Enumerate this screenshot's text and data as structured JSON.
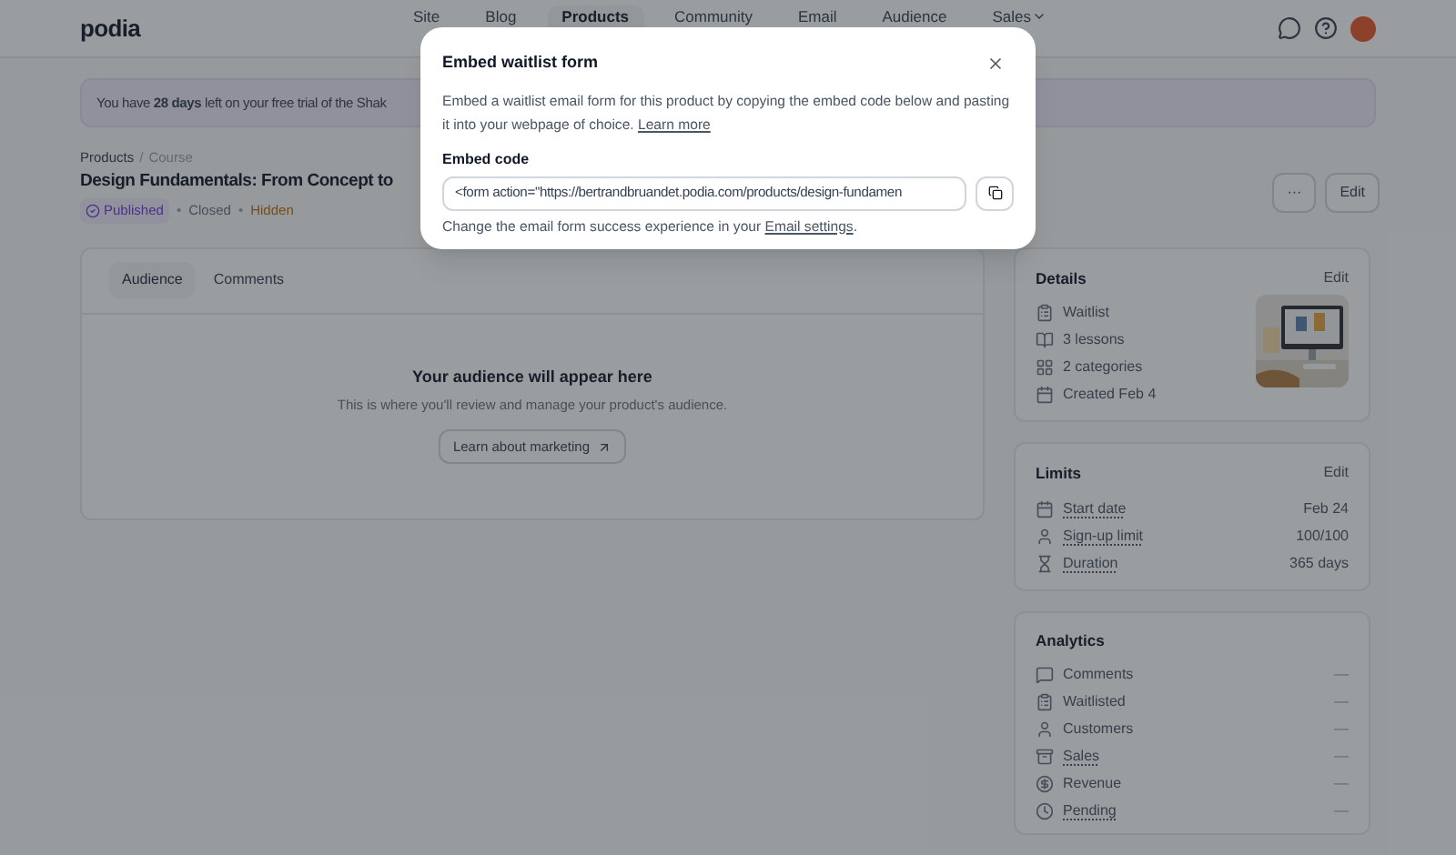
{
  "nav": {
    "logo": "podia",
    "items": [
      {
        "label": "Site",
        "selected": false,
        "has_menu": false
      },
      {
        "label": "Blog",
        "selected": false,
        "has_menu": false
      },
      {
        "label": "Products",
        "selected": true,
        "has_menu": false
      },
      {
        "label": "Community",
        "selected": false,
        "has_menu": false
      },
      {
        "label": "Email",
        "selected": false,
        "has_menu": false
      },
      {
        "label": "Audience",
        "selected": false,
        "has_menu": false
      },
      {
        "label": "Sales",
        "selected": false,
        "has_menu": true
      }
    ]
  },
  "banner": "You have **28 days** left on your free trial of the Shak",
  "breadcrumb": [
    "Products",
    "Course"
  ],
  "breadcrumb_separator": "/",
  "title": "Design Fundamentals: From Concept to",
  "statuses": [
    {
      "label": "Published",
      "kind": "badge"
    },
    {
      "label": "Closed",
      "kind": "plain",
      "prefix": "•"
    },
    {
      "label": "Hidden",
      "kind": "warning",
      "prefix": "•"
    }
  ],
  "actions": [
    "···",
    "Edit"
  ],
  "tabs": [
    {
      "label": "Audience",
      "selected": true
    },
    {
      "label": "Comments",
      "selected": false
    }
  ],
  "empty_state": {
    "title": "Your audience will appear here",
    "text": "This is where you'll review and manage your product's audience.",
    "button": "Learn about marketing"
  },
  "details": {
    "title": "Details",
    "edit": "Edit",
    "items": [
      "Waitlist",
      "3 lessons",
      "2 categories",
      "Created Feb 4"
    ]
  },
  "limits": {
    "title": "Limits",
    "edit": "Edit",
    "rows": [
      {
        "label": "Start date",
        "value": "Feb 24",
        "dotted_underline": true
      },
      {
        "label": "Sign-up limit",
        "value": "100/100",
        "dotted_underline": true
      },
      {
        "label": "Duration",
        "value": "365 days",
        "dotted_underline": true
      }
    ]
  },
  "analytics": {
    "title": "Analytics",
    "rows": [
      {
        "label": "Comments",
        "value": "—",
        "dotted_underline": false
      },
      {
        "label": "Waitlisted",
        "value": "—",
        "dotted_underline": false
      },
      {
        "label": "Customers",
        "value": "—",
        "dotted_underline": false
      },
      {
        "label": "Sales",
        "value": "—",
        "dotted_underline": true
      },
      {
        "label": "Revenue",
        "value": "—",
        "dotted_underline": false
      },
      {
        "label": "Pending",
        "value": "—",
        "dotted_underline": true
      }
    ]
  },
  "modal": {
    "title": "Embed waitlist form",
    "text": "Embed a waitlist email form for this product by copying the embed code below and pasting it into your webpage of choice.",
    "link": "Learn more",
    "field_label": "Embed code",
    "code": "<form action=\"https://bertrandbruandet.podia.com/products/design-fundamen",
    "note": "Change the email form success experience in your",
    "note_link": "Email settings",
    "note_end": "."
  }
}
